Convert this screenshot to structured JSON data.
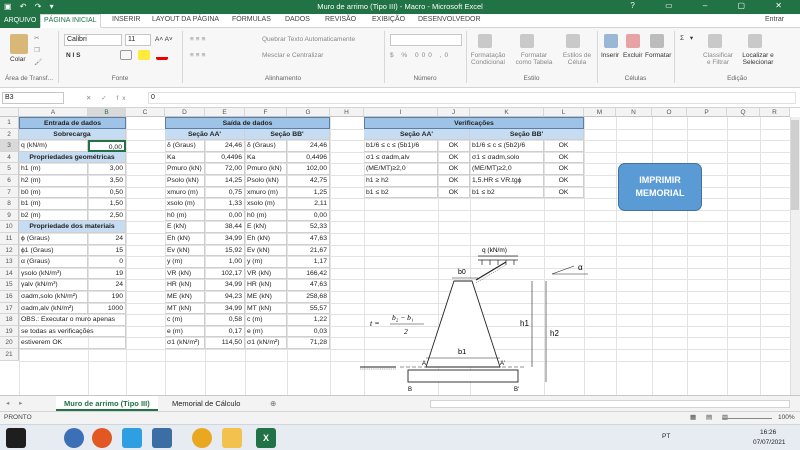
{
  "window": {
    "title": "Muro de arrimo (Tipo III) - Macro - Microsoft Excel",
    "qa": "▣ ↶ ↷ ▾",
    "controls": "? ▭ – ▢ ✕"
  },
  "tabs": {
    "file": "ARQUIVO",
    "items": [
      "PÁGINA INICIAL",
      "INSERIR",
      "LAYOUT DA PÁGINA",
      "FÓRMULAS",
      "DADOS",
      "REVISÃO",
      "EXIBIÇÃO",
      "DESENVOLVEDOR"
    ],
    "user": "Entrar"
  },
  "ribbon": {
    "paste": "Colar",
    "font_name": "Calibri",
    "font_size": "11",
    "font_sizes": "A˄ A˅",
    "bius": "N  I  S",
    "wrap": "Quebrar Texto Automaticamente",
    "merge": "Mesclar e Centralizar",
    "number_format": "",
    "cond": "Formatação Condicional",
    "table": "Formatar como Tabela",
    "styles": "Estilos de Célula",
    "insert": "Inserir",
    "delete": "Excluir",
    "format": "Formatar",
    "sort": "Classificar e Filtrar",
    "find": "Localizar e Selecionar",
    "groups": [
      "Área de Transf...",
      "Fonte",
      "Alinhamento",
      "Número",
      "Estilo",
      "Células",
      "Edição"
    ]
  },
  "formula": {
    "name_box": "B3",
    "icons": "✕ ✓ fx",
    "value": "0"
  },
  "columns": [
    "A",
    "B",
    "C",
    "D",
    "E",
    "F",
    "G",
    "H",
    "I",
    "J",
    "K",
    "L",
    "M",
    "N",
    "O",
    "P",
    "Q",
    "R"
  ],
  "rows": [
    "1",
    "2",
    "3",
    "4",
    "5",
    "6",
    "7",
    "8",
    "9",
    "10",
    "11",
    "12",
    "13",
    "14",
    "15",
    "16",
    "17",
    "18",
    "19",
    "20",
    "21"
  ],
  "input": {
    "title": "Entrada de dados",
    "sub1": "Sobrecarga",
    "sub2": "Propriedades geométricas",
    "sub3": "Propriedade dos materiais",
    "q": [
      "q (kN/m)",
      "0,00"
    ],
    "geo": [
      [
        "h1 (m)",
        "3,00"
      ],
      [
        "h2 (m)",
        "3,50"
      ],
      [
        "b0 (m)",
        "0,50"
      ],
      [
        "b1 (m)",
        "1,50"
      ],
      [
        "b2 (m)",
        "2,50"
      ]
    ],
    "mat": [
      [
        "ϕ (Graus)",
        "24"
      ],
      [
        "ϕ1 (Graus)",
        "15"
      ],
      [
        "α (Graus)",
        "0"
      ],
      [
        "γsolo (kN/m³)",
        "19"
      ],
      [
        "γalv (kN/m³)",
        "24"
      ],
      [
        "σadm,solo (kN/m²)",
        "190"
      ],
      [
        "σadm,alv (kN/m²)",
        "1000"
      ]
    ],
    "obs": [
      "OBS.: Executar o muro apenas",
      "se todas as verificações",
      "estiverem OK"
    ]
  },
  "output": {
    "title": "Saída de dados",
    "aa": "Seção AA'",
    "bb": "Seção BB'",
    "rows": [
      [
        "δ (Graus)",
        "24,46",
        "δ (Graus)",
        "24,46"
      ],
      [
        "Ka",
        "0,4496",
        "Ka",
        "0,4496"
      ],
      [
        "Pmuro (kN)",
        "72,00",
        "Pmuro (kN)",
        "102,00"
      ],
      [
        "Psolo (kN)",
        "14,25",
        "Psolo (kN)",
        "42,75"
      ],
      [
        "xmuro (m)",
        "0,75",
        "xmuro (m)",
        "1,25"
      ],
      [
        "xsolo (m)",
        "1,33",
        "xsolo (m)",
        "2,11"
      ],
      [
        "h0 (m)",
        "0,00",
        "h0 (m)",
        "0,00"
      ],
      [
        "E (kN)",
        "38,44",
        "E (kN)",
        "52,33"
      ],
      [
        "Eh (kN)",
        "34,99",
        "Eh (kN)",
        "47,63"
      ],
      [
        "Ev (kN)",
        "15,92",
        "Ev (kN)",
        "21,67"
      ],
      [
        "y (m)",
        "1,00",
        "y (m)",
        "1,17"
      ],
      [
        "VR (kN)",
        "102,17",
        "VR (kN)",
        "166,42"
      ],
      [
        "HR (kN)",
        "34,99",
        "HR (kN)",
        "47,63"
      ],
      [
        "ME (kN)",
        "94,23",
        "ME (kN)",
        "258,68"
      ],
      [
        "MT (kN)",
        "34,99",
        "MT (kN)",
        "55,57"
      ],
      [
        "c (m)",
        "0,58",
        "c (m)",
        "1,22"
      ],
      [
        "e (m)",
        "0,17",
        "e (m)",
        "0,03"
      ],
      [
        "σ1 (kN/m²)",
        "114,50",
        "σ1 (kN/m²)",
        "71,28"
      ]
    ]
  },
  "verif": {
    "title": "Verificações",
    "aa": "Seção AA'",
    "bb": "Seção BB'",
    "rows": [
      [
        "b1/6 ≤ c ≤ (5b1)/6",
        "OK",
        "b1/6 ≤ c ≤ (5b2)/6",
        "OK"
      ],
      [
        "σ1 ≤ σadm,alv",
        "OK",
        "σ1 ≤ σadm,solo",
        "OK"
      ],
      [
        "(ME/MT)≥2,0",
        "OK",
        "(ME/MT)≥2,0",
        "OK"
      ],
      [
        "h1 ≥ h2",
        "OK",
        "1,5.HR ≤ VR.tgϕ",
        "OK"
      ],
      [
        "b1 ≤ b2",
        "OK",
        "b1 ≤ b2",
        "OK"
      ]
    ]
  },
  "button": {
    "line1": "IMPRIMIR",
    "line2": "MEMORIAL"
  },
  "diagram": {
    "q": "q (kN/m)",
    "b0": "b0",
    "b1": "b1",
    "h1": "h1",
    "h2": "h2",
    "a": "A",
    "a2": "A'",
    "b": "B",
    "b2": "B'",
    "alpha": "α",
    "formula_t": "t =",
    "formula_num": "b₂ − b₁",
    "formula_den": "2"
  },
  "sheets": {
    "active": "Muro de arrimo (Tipo III)",
    "other": "Memorial de Cálculo",
    "add": "⊕"
  },
  "status": {
    "left": "PRONTO",
    "zoom": "100%"
  },
  "taskbar": {
    "lang": "PT",
    "time": "16:26",
    "date": "07/07/2021"
  }
}
